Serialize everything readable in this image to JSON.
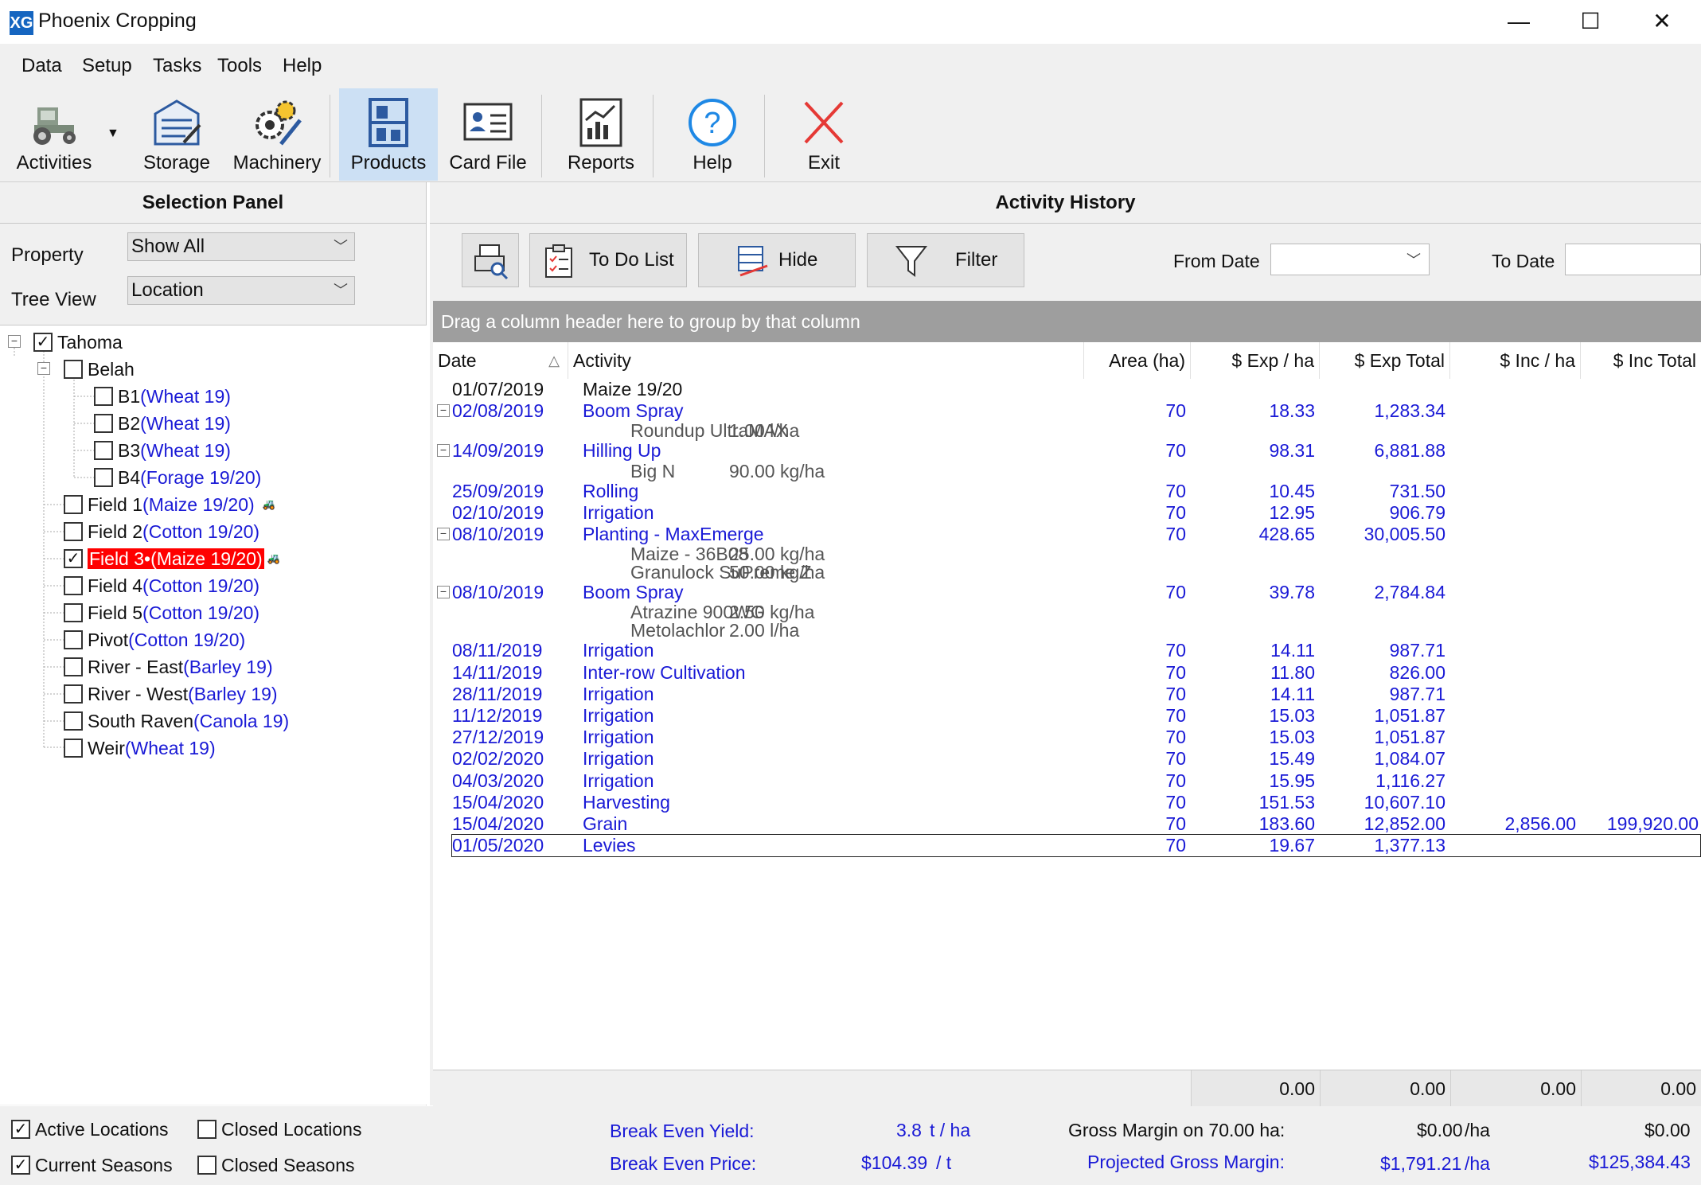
{
  "window": {
    "title": "Phoenix Cropping",
    "minimize": "—",
    "maximize": "☐",
    "close": "✕",
    "app_icon": "XG"
  },
  "menu": [
    "Data",
    "Setup",
    "Tasks",
    "Tools",
    "Help"
  ],
  "toolbar": {
    "activities": "Activities",
    "storage": "Storage",
    "machinery": "Machinery",
    "products": "Products",
    "card_file": "Card File",
    "reports": "Reports",
    "help": "Help",
    "exit": "Exit"
  },
  "selection_panel": {
    "title": "Selection Panel",
    "property_label": "Property",
    "property_value": "Show All",
    "tree_view_label": "Tree View",
    "tree_view_value": "Location"
  },
  "tree": {
    "root": "Tahoma",
    "belah": "Belah",
    "b1": "B1",
    "b1_crop": "(Wheat 19)",
    "b2": "B2",
    "b2_crop": "(Wheat 19)",
    "b3": "B3",
    "b3_crop": "(Wheat 19)",
    "b4": "B4",
    "b4_crop": "(Forage 19/20)",
    "f1": "Field 1",
    "f1_crop": "(Maize 19/20)",
    "f2": "Field 2",
    "f2_crop": "(Cotton 19/20)",
    "f3": "Field 3•(Maize 19/20)",
    "f4": "Field 4",
    "f4_crop": "(Cotton 19/20)",
    "f5": "Field 5",
    "f5_crop": "(Cotton 19/20)",
    "pivot": "Pivot",
    "pivot_crop": "(Cotton 19/20)",
    "re": "River - East",
    "re_crop": "(Barley 19)",
    "rw": "River - West",
    "rw_crop": "(Barley 19)",
    "sr": "South Raven",
    "sr_crop": "(Canola 19)",
    "weir": "Weir",
    "weir_crop": "(Wheat 19)"
  },
  "activity_history": {
    "title": "Activity History",
    "print_icon": "print-preview-icon",
    "todo": "To Do List",
    "hide": "Hide",
    "filter": "Filter",
    "from_date_label": "From Date",
    "to_date_label": "To Date",
    "group_hint": "Drag a column header here to group by that column",
    "columns": {
      "date": "Date",
      "activity": "Activity",
      "area": "Area (ha)",
      "exp_ha": "$ Exp / ha",
      "exp_total": "$ Exp Total",
      "inc_ha": "$ Inc / ha",
      "inc_total": "$ Inc Total"
    },
    "rows": [
      {
        "date": "01/07/2019",
        "activity": "Maize 19/20",
        "area": "",
        "exp_ha": "",
        "exp_total": "",
        "inc_ha": "",
        "inc_total": ""
      },
      {
        "date": "02/08/2019",
        "activity": "Boom Spray",
        "area": "70",
        "exp_ha": "18.33",
        "exp_total": "1,283.34",
        "inc_ha": "",
        "inc_total": ""
      },
      {
        "product": "Roundup UltraMAX",
        "rate": "1.00 l/ha"
      },
      {
        "date": "14/09/2019",
        "activity": "Hilling Up",
        "area": "70",
        "exp_ha": "98.31",
        "exp_total": "6,881.88",
        "inc_ha": "",
        "inc_total": ""
      },
      {
        "product": "Big N",
        "rate": "90.00 kg/ha"
      },
      {
        "date": "25/09/2019",
        "activity": "Rolling",
        "area": "70",
        "exp_ha": "10.45",
        "exp_total": "731.50",
        "inc_ha": "",
        "inc_total": ""
      },
      {
        "date": "02/10/2019",
        "activity": "Irrigation",
        "area": "70",
        "exp_ha": "12.95",
        "exp_total": "906.79",
        "inc_ha": "",
        "inc_total": ""
      },
      {
        "date": "08/10/2019",
        "activity": "Planting - MaxEmerge",
        "area": "70",
        "exp_ha": "428.65",
        "exp_total": "30,005.50",
        "inc_ha": "",
        "inc_total": ""
      },
      {
        "product": "Maize - 36B08",
        "rate": "25.00 kg/ha"
      },
      {
        "product": "Granulock SuPreme Z",
        "rate": "50.00 kg/ha"
      },
      {
        "date": "08/10/2019",
        "activity": "Boom Spray",
        "area": "70",
        "exp_ha": "39.78",
        "exp_total": "2,784.84",
        "inc_ha": "",
        "inc_total": ""
      },
      {
        "product": "Atrazine 900WG",
        "rate": "2.50 kg/ha"
      },
      {
        "product": "Metolachlor",
        "rate": "2.00 l/ha"
      },
      {
        "date": "08/11/2019",
        "activity": "Irrigation",
        "area": "70",
        "exp_ha": "14.11",
        "exp_total": "987.71",
        "inc_ha": "",
        "inc_total": ""
      },
      {
        "date": "14/11/2019",
        "activity": "Inter-row Cultivation",
        "area": "70",
        "exp_ha": "11.80",
        "exp_total": "826.00",
        "inc_ha": "",
        "inc_total": ""
      },
      {
        "date": "28/11/2019",
        "activity": "Irrigation",
        "area": "70",
        "exp_ha": "14.11",
        "exp_total": "987.71",
        "inc_ha": "",
        "inc_total": ""
      },
      {
        "date": "11/12/2019",
        "activity": "Irrigation",
        "area": "70",
        "exp_ha": "15.03",
        "exp_total": "1,051.87",
        "inc_ha": "",
        "inc_total": ""
      },
      {
        "date": "27/12/2019",
        "activity": "Irrigation",
        "area": "70",
        "exp_ha": "15.03",
        "exp_total": "1,051.87",
        "inc_ha": "",
        "inc_total": ""
      },
      {
        "date": "02/02/2020",
        "activity": "Irrigation",
        "area": "70",
        "exp_ha": "15.49",
        "exp_total": "1,084.07",
        "inc_ha": "",
        "inc_total": ""
      },
      {
        "date": "04/03/2020",
        "activity": "Irrigation",
        "area": "70",
        "exp_ha": "15.95",
        "exp_total": "1,116.27",
        "inc_ha": "",
        "inc_total": ""
      },
      {
        "date": "15/04/2020",
        "activity": "Harvesting",
        "area": "70",
        "exp_ha": "151.53",
        "exp_total": "10,607.10",
        "inc_ha": "",
        "inc_total": ""
      },
      {
        "date": "15/04/2020",
        "activity": "Grain",
        "area": "70",
        "exp_ha": "183.60",
        "exp_total": "12,852.00",
        "inc_ha": "2,856.00",
        "inc_total": "199,920.00"
      },
      {
        "date": "01/05/2020",
        "activity": "Levies",
        "area": "70",
        "exp_ha": "19.67",
        "exp_total": "1,377.13",
        "inc_ha": "",
        "inc_total": ""
      }
    ],
    "totals": {
      "exp_ha": "0.00",
      "exp_total": "0.00",
      "inc_ha": "0.00",
      "inc_total": "0.00"
    }
  },
  "bottom": {
    "active_locations": "Active Locations",
    "closed_locations": "Closed Locations",
    "current_seasons": "Current Seasons",
    "closed_seasons": "Closed Seasons",
    "break_even_yield_label": "Break Even Yield:",
    "break_even_yield_value": "3.8",
    "break_even_yield_unit": "t / ha",
    "break_even_price_label": "Break Even Price:",
    "break_even_price_value": "$104.39",
    "break_even_price_unit": "/ t",
    "gross_margin_label": "Gross Margin on 70.00 ha:",
    "gross_margin_ha": "$0.00",
    "gross_margin_ha_unit": "/ha",
    "gross_margin_total": "$0.00",
    "projected_label": "Projected Gross Margin:",
    "projected_ha": "$1,791.21",
    "projected_ha_unit": "/ha",
    "projected_total": "$125,384.43"
  },
  "colors": {
    "accent_blue": "#1a1ad6",
    "selected_red": "#ff0000"
  }
}
